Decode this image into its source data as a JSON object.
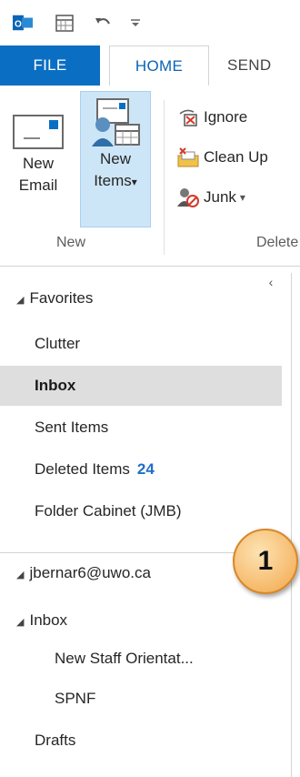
{
  "tabs": {
    "file": "FILE",
    "home": "HOME",
    "send": "SEND"
  },
  "ribbon": {
    "new_email_line1": "New",
    "new_email_line2": "Email",
    "new_items_line1": "New",
    "new_items_line2": "Items",
    "new_items_arrow": "▾",
    "group_new": "New",
    "ignore": "Ignore",
    "clean_up": "Clean Up",
    "junk": "Junk",
    "junk_arrow": "▾",
    "group_delete": "Delete"
  },
  "folders": {
    "collapse_glyph": "‹",
    "favorites_label": "Favorites",
    "favorites": [
      {
        "label": "Clutter"
      },
      {
        "label": "Inbox"
      },
      {
        "label": "Sent Items"
      },
      {
        "label": "Deleted Items",
        "count": "24"
      },
      {
        "label": "Folder Cabinet (JMB)"
      }
    ],
    "account": "jbernar6@uwo.ca",
    "inbox_label": "Inbox",
    "subfolders": [
      "New Staff Orientat...",
      "SPNF"
    ],
    "drafts": "Drafts"
  },
  "callout": {
    "number": "1"
  },
  "colors": {
    "file_tab": "#0a6fc2",
    "accent_text": "#0a63b8",
    "selected_row": "#dedede",
    "count_blue": "#1e6ec8",
    "callout_orange": "#f7c27a"
  },
  "icons": [
    "outlook-icon",
    "calendar-icon",
    "undo-icon",
    "customize-icon",
    "new-email-icon",
    "new-items-icon",
    "ignore-icon",
    "clean-up-icon",
    "junk-icon",
    "collapse-icon"
  ]
}
